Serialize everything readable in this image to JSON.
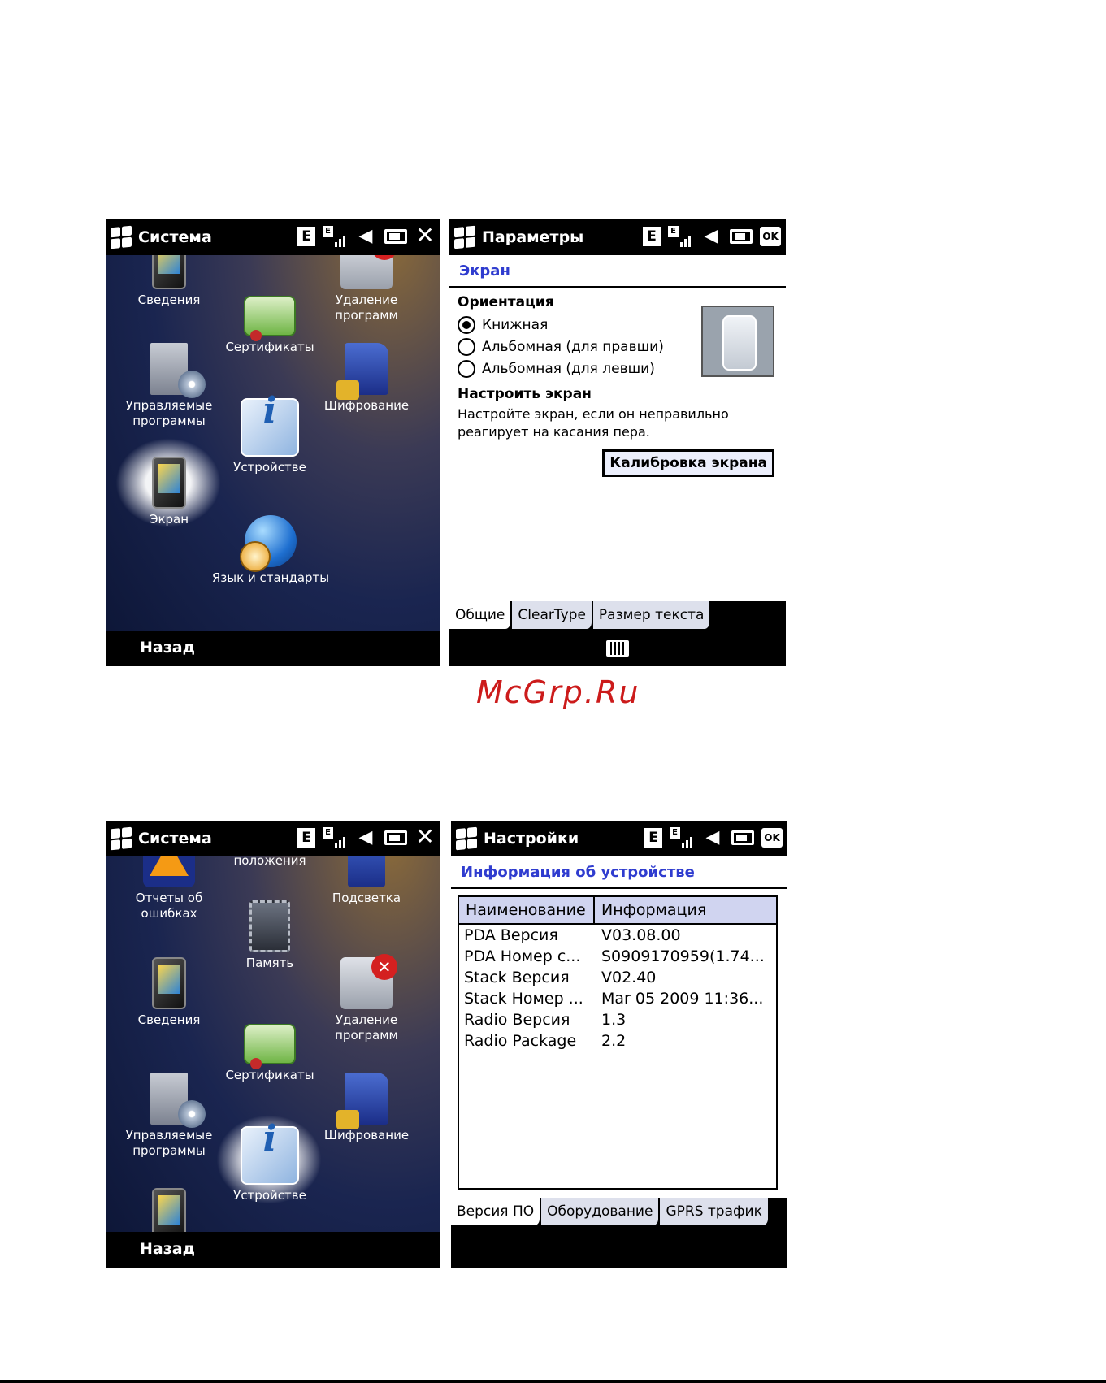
{
  "watermark": "McGrp.Ru",
  "screens": {
    "system1": {
      "title": "Система",
      "icons": [
        {
          "label": "Сведения",
          "icon": "phone-info-icon"
        },
        {
          "label": "Удаление программ",
          "icon": "remove-programs-icon"
        },
        {
          "label": "Сертификаты",
          "icon": "certificate-icon"
        },
        {
          "label": "Управляемые программы",
          "icon": "managed-programs-icon"
        },
        {
          "label": "Шифрование",
          "icon": "encryption-icon"
        },
        {
          "label": "Устройстве",
          "icon": "device-info-icon"
        },
        {
          "label": "Экран",
          "icon": "screen-icon"
        },
        {
          "label": "Язык и стандарты",
          "icon": "regional-settings-icon"
        }
      ],
      "softkey": "Назад"
    },
    "params": {
      "title": "Параметры",
      "header": "Экран",
      "orientation_title": "Ориентация",
      "options": [
        "Книжная",
        "Альбомная (для правши)",
        "Альбомная (для левши)"
      ],
      "selected_option": "Книжная",
      "align_title": "Настроить экран",
      "align_text": "Настройте экран, если он неправильно реагирует на касания пера.",
      "calibrate_button": "Калибровка экрана",
      "tabs": [
        "Общие",
        "ClearType",
        "Размер текста"
      ],
      "active_tab": "Общие"
    },
    "system2": {
      "title": "Система",
      "partial_label": "положения",
      "icons": [
        {
          "label": "Отчеты об ошибках",
          "icon": "error-report-icon"
        },
        {
          "label": "Подсветка",
          "icon": "backlight-icon"
        },
        {
          "label": "Память",
          "icon": "memory-icon"
        },
        {
          "label": "Сведения",
          "icon": "phone-info-icon"
        },
        {
          "label": "Удаление программ",
          "icon": "remove-programs-icon"
        },
        {
          "label": "Сертификаты",
          "icon": "certificate-icon"
        },
        {
          "label": "Управляемые программы",
          "icon": "managed-programs-icon"
        },
        {
          "label": "Шифрование",
          "icon": "encryption-icon"
        },
        {
          "label": "Устройстве",
          "icon": "device-info-icon"
        }
      ],
      "softkey": "Назад"
    },
    "device_info": {
      "title": "Настройки",
      "header": "Информация об устройстве",
      "columns": [
        "Наименование",
        "Информация"
      ],
      "rows": [
        [
          "PDA Версия",
          "V03.08.00"
        ],
        [
          "PDA Номер с...",
          "S0909170959(1.74..."
        ],
        [
          "Stack Версия",
          "V02.40"
        ],
        [
          "Stack Номер ...",
          "Mar 05 2009 11:36..."
        ],
        [
          "Radio Версия",
          "1.3"
        ],
        [
          "Radio Package",
          "2.2"
        ]
      ],
      "tabs": [
        "Версия ПО",
        "Оборудование",
        "GPRS трафик"
      ],
      "active_tab": "Версия ПО"
    }
  }
}
